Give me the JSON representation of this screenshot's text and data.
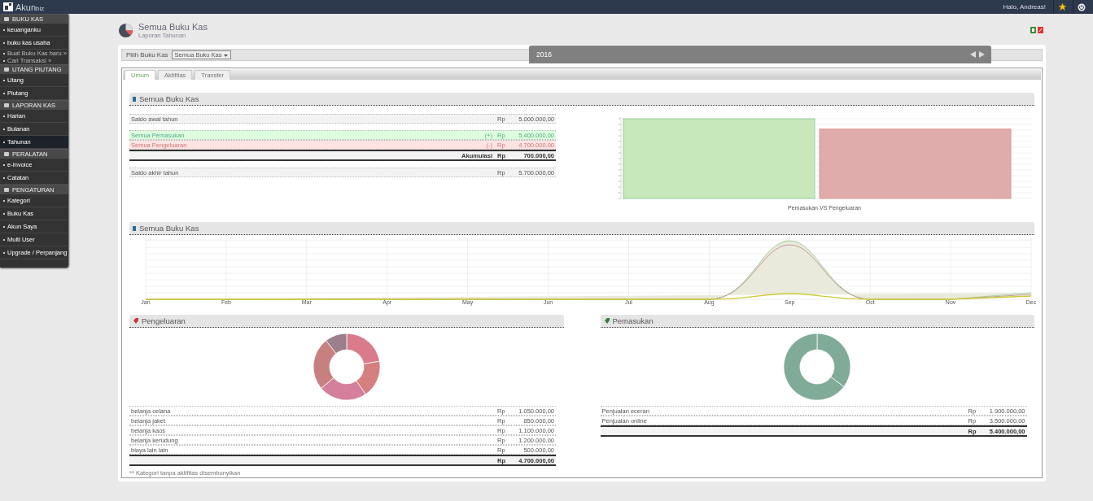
{
  "topbar": {
    "logo": "Akun",
    "logo_suffix": "biz",
    "greeting": "Halo, Andreas!"
  },
  "sidebar": {
    "sections": [
      {
        "title": "BUKU KAS",
        "items": [
          {
            "label": "keuanganku",
            "kind": "item",
            "selected": false
          },
          {
            "label": "buku kas usaha",
            "kind": "item",
            "selected": false
          },
          {
            "label": "Buat Buku Kas baru »",
            "kind": "sub",
            "selected": false
          },
          {
            "label": "Cari Transaksi »",
            "kind": "sub",
            "selected": false
          }
        ]
      },
      {
        "title": "UTANG PIUTANG",
        "items": [
          {
            "label": "Utang",
            "kind": "item",
            "selected": false
          },
          {
            "label": "Piutang",
            "kind": "item",
            "selected": false
          }
        ]
      },
      {
        "title": "LAPORAN KAS",
        "items": [
          {
            "label": "Harian",
            "kind": "item",
            "selected": false
          },
          {
            "label": "Bulanan",
            "kind": "item",
            "selected": false
          },
          {
            "label": "Tahunan",
            "kind": "item",
            "selected": true
          }
        ]
      },
      {
        "title": "PERALATAN",
        "items": [
          {
            "label": "e-Invoice",
            "kind": "item",
            "selected": false
          },
          {
            "label": "Catatan",
            "kind": "item",
            "selected": false
          }
        ]
      },
      {
        "title": "PENGATURAN",
        "items": [
          {
            "label": "Kategori",
            "kind": "item",
            "selected": false
          },
          {
            "label": "Buku Kas",
            "kind": "item",
            "selected": false
          },
          {
            "label": "Akun Saya",
            "kind": "item",
            "selected": false
          },
          {
            "label": "Multi User",
            "kind": "item",
            "selected": false
          },
          {
            "label": "Upgrade / Perpanjang",
            "kind": "item",
            "selected": false
          }
        ]
      }
    ]
  },
  "page": {
    "title": "Semua Buku Kas",
    "subtitle": "Laporan Tahunan"
  },
  "filter": {
    "label": "Pilih Buku Kas",
    "value": "Semua Buku Kas"
  },
  "year_bar": {
    "year": "2016"
  },
  "tabs": [
    {
      "label": "Umum",
      "selected": true
    },
    {
      "label": "Aktifitas",
      "selected": false
    },
    {
      "label": "Transfer",
      "selected": false
    }
  ],
  "summary": {
    "title": "Semua Buku Kas",
    "rows": [
      {
        "kind": "plain",
        "label": "Saldo awal tahun",
        "sign": "",
        "currency": "Rp",
        "amount": "5.000.000,00"
      },
      {
        "kind": "income",
        "label": "Semua Pemasukan",
        "sign": "(+)",
        "currency": "Rp",
        "amount": "5.400.000,00"
      },
      {
        "kind": "expense",
        "label": "Semua Pengeluaran",
        "sign": "(-)",
        "currency": "Rp",
        "amount": "4.700.000,00"
      },
      {
        "kind": "total",
        "label": "Akumulasi",
        "sign": "",
        "currency": "Rp",
        "amount": "700.000,00"
      },
      {
        "kind": "plain",
        "label": "Saldo akhir tahun",
        "sign": "",
        "currency": "Rp",
        "amount": "5.700.000,00"
      }
    ],
    "bar_chart_label": "Pemasukan VS Pengeluaran"
  },
  "trend": {
    "title": "Semua Buku Kas",
    "months": [
      "Jan",
      "Feb",
      "Mar",
      "Apr",
      "May",
      "Jun",
      "Jul",
      "Aug",
      "Sep",
      "Oct",
      "Nov",
      "Dec"
    ]
  },
  "expenses": {
    "title": "Pengeluaran",
    "rows": [
      {
        "label": "belanja celana",
        "currency": "Rp",
        "amount": "1.050.000,00",
        "color": "#d97b8a"
      },
      {
        "label": "belanja jaket",
        "currency": "Rp",
        "amount": "850.000,00",
        "color": "#d4807f"
      },
      {
        "label": "belanja kaos",
        "currency": "Rp",
        "amount": "1.100.000,00",
        "color": "#d47f9c"
      },
      {
        "label": "belanja kerudung",
        "currency": "Rp",
        "amount": "1.200.000,00",
        "color": "#c77f80"
      },
      {
        "label": "biaya lain lain",
        "currency": "Rp",
        "amount": "500.000,00",
        "color": "#9c7f8c"
      }
    ],
    "total_currency": "Rp",
    "total": "4.700.000,00",
    "note": "** Kategori tanpa aktifitas disembunyikan"
  },
  "income": {
    "title": "Pemasukan",
    "rows": [
      {
        "label": "Penjualan eceran",
        "currency": "Rp",
        "amount": "1.900.000,00",
        "color": "#80ab98"
      },
      {
        "label": "Penjualan online",
        "currency": "Rp",
        "amount": "3.500.000,00",
        "color": "#80ab98"
      }
    ],
    "total_currency": "Rp",
    "total": "5.400.000,00"
  }
}
